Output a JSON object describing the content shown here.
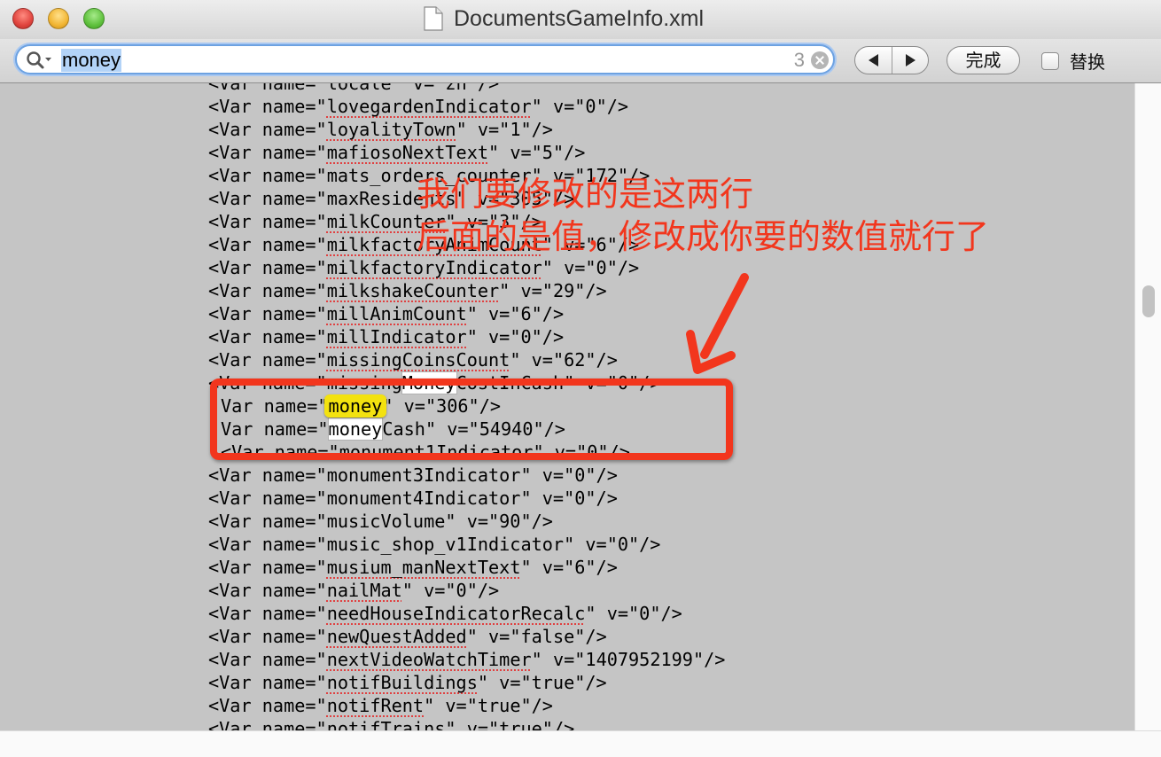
{
  "window": {
    "title": "DocumentsGameInfo.xml"
  },
  "findbar": {
    "search_value": "money",
    "match_count": "3",
    "done_label": "完成",
    "replace_label": "替换"
  },
  "lines": [
    "<Var name=\"locale\" v=\"zh\"/>",
    "<Var name=\"lovegardenIndicator\" v=\"0\"/>",
    "<Var name=\"loyalityTown\" v=\"1\"/>",
    "<Var name=\"mafiosoNextText\" v=\"5\"/>",
    "<Var name=\"mats_orders_counter\" v=\"172\"/>",
    "<Var name=\"maxResidents\" v=\"305\"/>",
    "<Var name=\"milkCounter\" v=\"3\"/>",
    "<Var name=\"milkfactoryAnimCount\" v=\"6\"/>",
    "<Var name=\"milkfactoryIndicator\" v=\"0\"/>",
    "<Var name=\"milkshakeCounter\" v=\"29\"/>",
    "<Var name=\"millAnimCount\" v=\"6\"/>",
    "<Var name=\"millIndicator\" v=\"0\"/>",
    "<Var name=\"missingCoinsCount\" v=\"62\"/>",
    "<Var name=\"missingMoneyCostInCash\" v=\"0\"/>",
    "Var name=\"money\" v=\"306\"/>",
    "Var name=\"moneyCash\" v=\"54940\"/>",
    "<Var name=\"monument1Indicator\" v=\"0\"/>",
    "<Var name=\"monument3Indicator\" v=\"0\"/>",
    "<Var name=\"monument4Indicator\" v=\"0\"/>",
    "<Var name=\"musicVolume\" v=\"90\"/>",
    "<Var name=\"music_shop_v1Indicator\" v=\"0\"/>",
    "<Var name=\"musium_manNextText\" v=\"6\"/>",
    "<Var name=\"nailMat\" v=\"0\"/>",
    "<Var name=\"needHouseIndicatorRecalc\" v=\"0\"/>",
    "<Var name=\"newQuestAdded\" v=\"false\"/>",
    "<Var name=\"nextVideoWatchTimer\" v=\"1407952199\"/>",
    "<Var name=\"notifBuildings\" v=\"true\"/>",
    "<Var name=\"notifRent\" v=\"true\"/>",
    "<Var name=\"notifTrains\" v=\"true\"/>"
  ],
  "annotation": {
    "line1": "我们要修改的是这两行",
    "line2": "后面的是值，修改成你要的数值就行了"
  },
  "colors": {
    "annotation_red": "#f2361d",
    "match_highlight": "#f3e20f",
    "content_bg": "#c5c5c5"
  }
}
